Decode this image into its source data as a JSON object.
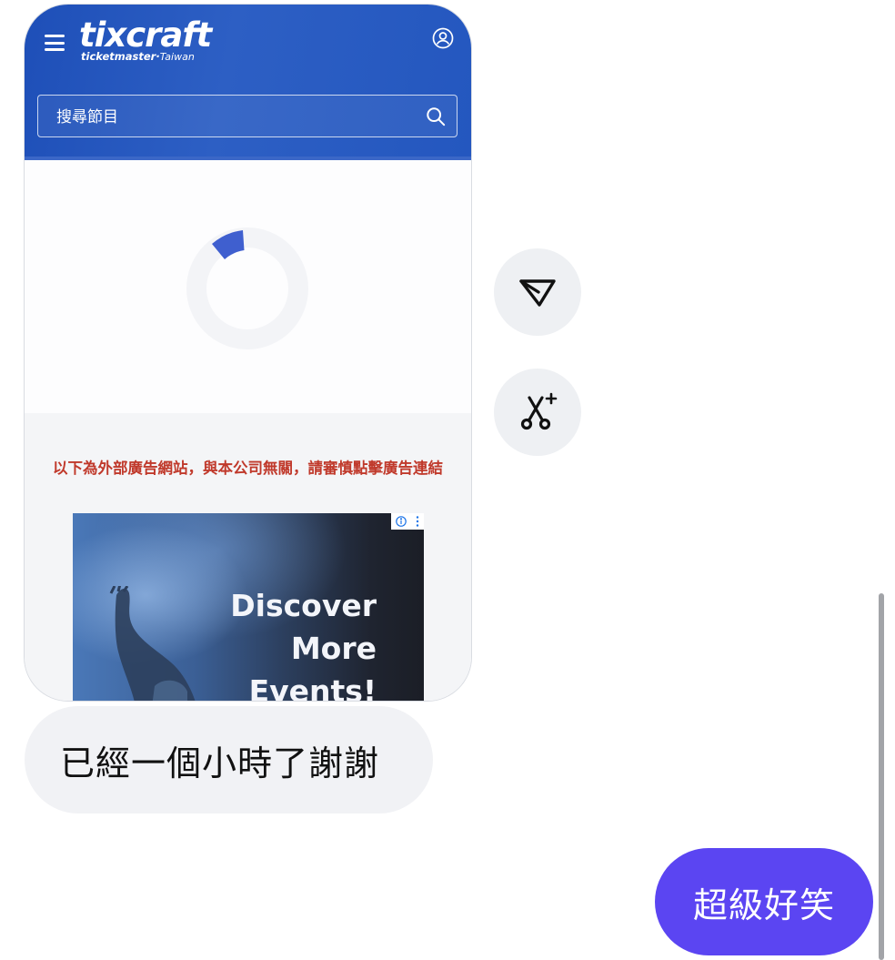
{
  "shared_screenshot": {
    "header": {
      "logo_main": "tixcraft",
      "logo_sub": "ticketmaster",
      "logo_region": "Taiwan",
      "search_placeholder": "搜尋節目"
    },
    "ad_notice": "以下為外部廣告網站，與本公司無關，請審慎點擊廣告連結",
    "ad_banner": {
      "line1": "Discover",
      "line2": "More",
      "line3": "Events!"
    }
  },
  "actions": {
    "share_icon": "send-icon",
    "ai_edit_icon": "scissors-sparkle-icon"
  },
  "messages": {
    "incoming": "已經一個小時了謝謝",
    "outgoing": "超級好笑"
  },
  "colors": {
    "header_blue": "#2457bf",
    "outgoing_bubble": "#5b45f2",
    "incoming_bubble": "#f1f2f5",
    "ad_notice_red": "#c0392b"
  }
}
